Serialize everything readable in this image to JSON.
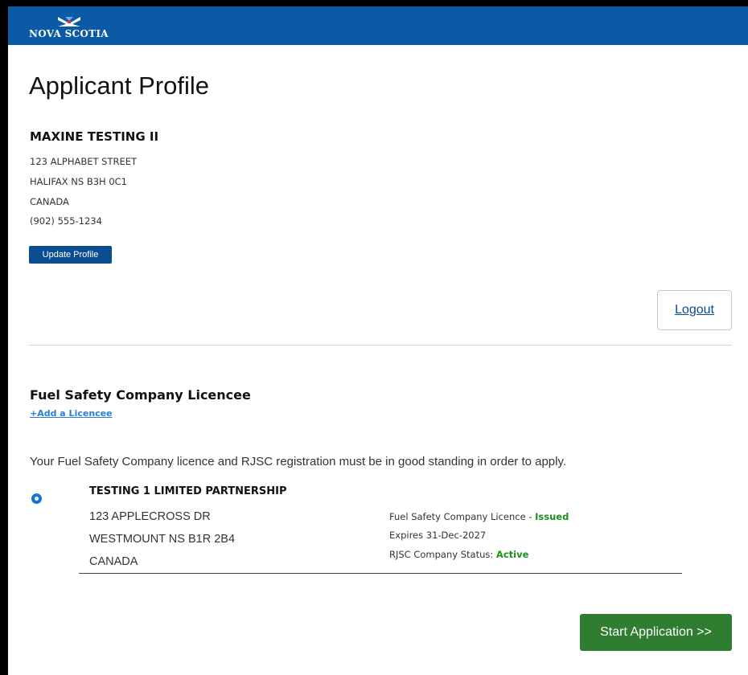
{
  "header": {
    "logo_text": "NOVA SCOTIA",
    "logo_icon": "nova-scotia-flag-icon",
    "color": "#0a5aa6"
  },
  "page": {
    "title": "Applicant Profile"
  },
  "applicant": {
    "name": "MAXINE TESTING II",
    "address_line1": "123 ALPHABET STREET",
    "address_line2": "HALIFAX NS B3H 0C1",
    "country": "CANADA",
    "phone": "(902) 555-1234"
  },
  "buttons": {
    "update_profile": "Update Profile",
    "logout": "Logout",
    "start_application": "Start Application >>"
  },
  "licencee_section": {
    "title": "Fuel Safety Company Licencee",
    "add_link": "+Add a Licencee",
    "notice": "Your Fuel Safety Company licence and RJSC registration must be in good standing in order to apply.",
    "companies": [
      {
        "selected": true,
        "name": "TESTING 1 LIMITED PARTNERSHIP",
        "address_line1": "123 APPLECROSS DR",
        "address_line2": "WESTMOUNT NS B1R 2B4",
        "country": "CANADA",
        "licence_label": "Fuel Safety Company Licence - ",
        "licence_status": "Issued",
        "expires": "Expires 31-Dec-2027",
        "rjsc_label": "RJSC Company Status: ",
        "rjsc_status": "Active"
      }
    ]
  },
  "colors": {
    "primary": "#0b4d91",
    "link": "#2a7fd2",
    "success": "#1b8f1b",
    "start_button": "#2f7d31"
  }
}
